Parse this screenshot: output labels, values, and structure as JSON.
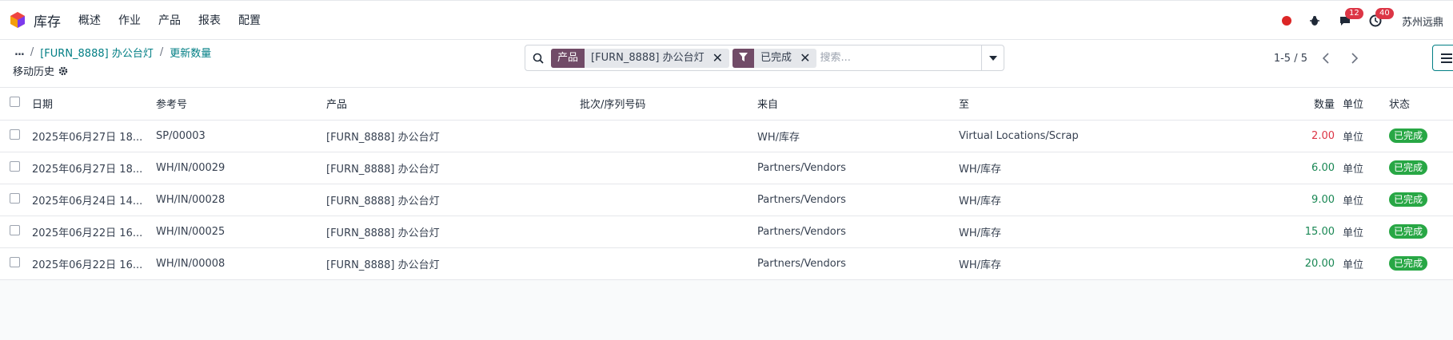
{
  "app": {
    "name": "库存",
    "menu": [
      "概述",
      "作业",
      "产品",
      "报表",
      "配置"
    ],
    "brand_colors": {
      "primary": "#714b67",
      "link": "#017e84",
      "success": "#28a745",
      "danger": "#dc3545"
    }
  },
  "systray": {
    "messages_count": "12",
    "activities_count": "40",
    "company": "苏州远鼎"
  },
  "breadcrumb": {
    "ellipsis": "...",
    "sep1": "/",
    "product": "[FURN_8888] 办公台灯",
    "sep2": "/",
    "current": "更新数量"
  },
  "subtitle": "移动历史",
  "search": {
    "facets": [
      {
        "label": "产品",
        "value": "[FURN_8888] 办公台灯"
      },
      {
        "label": "filter",
        "value": "已完成"
      }
    ],
    "placeholder": "搜索..."
  },
  "pager": {
    "value": "1-5 / 5"
  },
  "table": {
    "columns": [
      "日期",
      "参考号",
      "产品",
      "批次/序列号码",
      "来自",
      "至",
      "数量",
      "单位",
      "状态"
    ],
    "rows": [
      {
        "date": "2025年06月27日 18...",
        "ref": "SP/00003",
        "product": "[FURN_8888] 办公台灯",
        "lot": "",
        "from": "WH/库存",
        "to": "Virtual Locations/Scrap",
        "qty": "2.00",
        "qty_color": "red",
        "uom": "单位",
        "state": "已完成"
      },
      {
        "date": "2025年06月27日 18...",
        "ref": "WH/IN/00029",
        "product": "[FURN_8888] 办公台灯",
        "lot": "",
        "from": "Partners/Vendors",
        "to": "WH/库存",
        "qty": "6.00",
        "qty_color": "green",
        "uom": "单位",
        "state": "已完成"
      },
      {
        "date": "2025年06月24日 14...",
        "ref": "WH/IN/00028",
        "product": "[FURN_8888] 办公台灯",
        "lot": "",
        "from": "Partners/Vendors",
        "to": "WH/库存",
        "qty": "9.00",
        "qty_color": "green",
        "uom": "单位",
        "state": "已完成"
      },
      {
        "date": "2025年06月22日 16...",
        "ref": "WH/IN/00025",
        "product": "[FURN_8888] 办公台灯",
        "lot": "",
        "from": "Partners/Vendors",
        "to": "WH/库存",
        "qty": "15.00",
        "qty_color": "green",
        "uom": "单位",
        "state": "已完成"
      },
      {
        "date": "2025年06月22日 16...",
        "ref": "WH/IN/00008",
        "product": "[FURN_8888] 办公台灯",
        "lot": "",
        "from": "Partners/Vendors",
        "to": "WH/库存",
        "qty": "20.00",
        "qty_color": "green",
        "uom": "单位",
        "state": "已完成"
      }
    ]
  }
}
